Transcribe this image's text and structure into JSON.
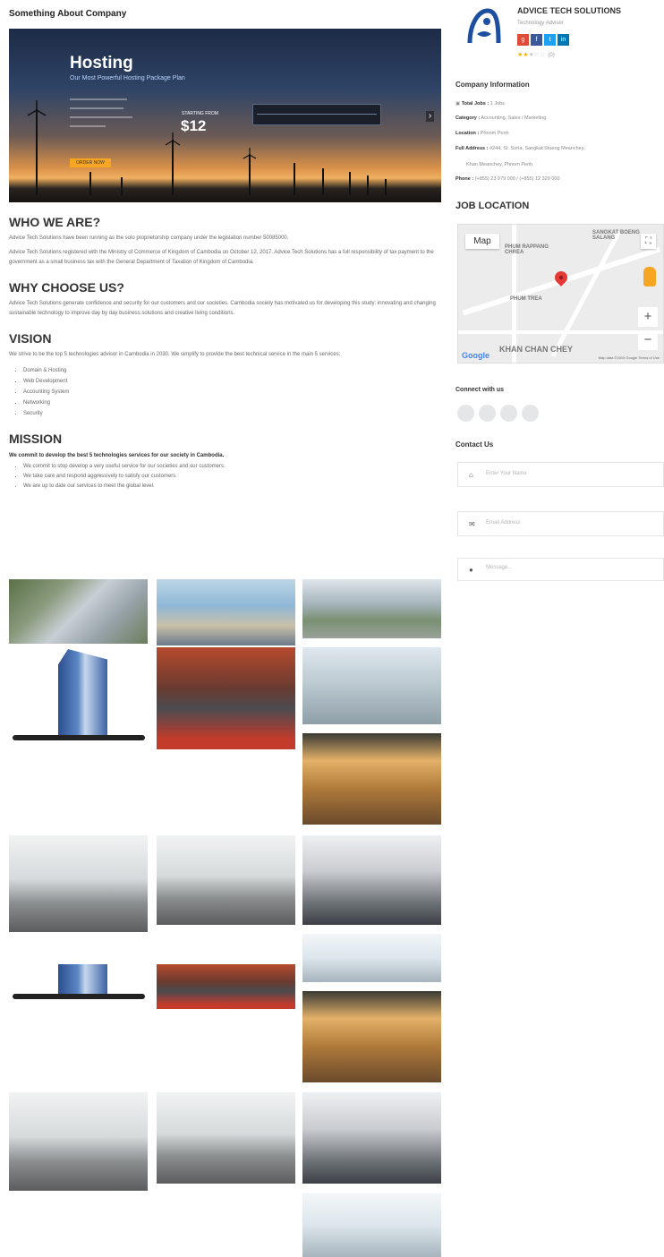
{
  "left": {
    "section_title": "Something About Company",
    "hero": {
      "title": "Hosting",
      "subtitle": "Our Most Powerful Hosting Package Plan",
      "starting_from": "STARTING FROM",
      "price": "$12",
      "button": "ORDER NOW"
    },
    "who": {
      "heading": "WHO WE ARE?",
      "p1": "Advice Tech Solutions have been running as the solo proprietorship company under the legislation number 50085000.",
      "p2": "Advice Tech Solutions registered with the Ministry of Commerce of Kingdom of Cambodia on October 12, 2017. Advice Tech Solutions has a full responsibility of tax payment to the government as a small business tax with the General Department of Taxation of Kingdom of Cambodia."
    },
    "why": {
      "heading": "WHY CHOOSE US?",
      "p1": "Advice Tech Solutions generate confidence and security for our customers and our societies. Cambodia society has motivated us for developing this study: innovating and changing sustainable technology to improve day by day business solutions and creative living conditions."
    },
    "vision": {
      "heading": "VISION",
      "p1": "We strive to be the top 5 technologies advisor in Cambodia in 2030. We simplify to provide the best technical service in the main 5 services:",
      "bullets": [
        "Domain & Hosting",
        "Web Development",
        "Accounting System",
        "Networking",
        "Security"
      ]
    },
    "mission": {
      "heading": "MISSION",
      "lead": "We commit to develop the best 5 technologies services for our society in Cambodia.",
      "bullets": [
        "We commit to stop develop a very useful service for our societies and our customers.",
        "We take care and respond aggressively to satisfy our customers.",
        "We are up to date our services to meet the global level."
      ]
    }
  },
  "right": {
    "company_name": "ADVICE TECH SOLUTIONS",
    "company_type": "Technology Adviser",
    "rating": {
      "value": 2.5,
      "max": 5,
      "count": "(0)"
    },
    "socials": [
      "google-plus",
      "facebook",
      "twitter",
      "linkedin"
    ],
    "info": {
      "title": "Company Information",
      "total_jobs_label": "Total Jobs :",
      "total_jobs_value": " 1 Jobs",
      "category_label": "Category :",
      "category_value": " Accounting, Sales / Marketing",
      "location_label": "Location :",
      "location_value": " Phnom Penh",
      "address_label": "Full Address :",
      "address_value": " #244, St. Sorla, Sangkat Stueng Meanchey,",
      "address_value2": "Khan Meanchey, Phnom Penh",
      "phone_label": "Phone :",
      "phone_value": " (+855) 23 979 000 / (+855) 12 320 000"
    },
    "job_location": "JOB LOCATION",
    "map": {
      "map_button": "Map",
      "labels": [
        "SANGKAT BOENG SALANG",
        "PHUM RAPPANG CHREA",
        "PHUM TREA",
        "KHAN CHAN CHEY"
      ],
      "footer": "Map data ©2019 Google   Terms of Use",
      "google": "Google"
    },
    "connect_title": "Connect with us",
    "contact_title": "Contact Us",
    "form": {
      "name_placeholder": "Enter Your Name",
      "email_placeholder": "Email Address",
      "message_placeholder": "Message..."
    }
  }
}
